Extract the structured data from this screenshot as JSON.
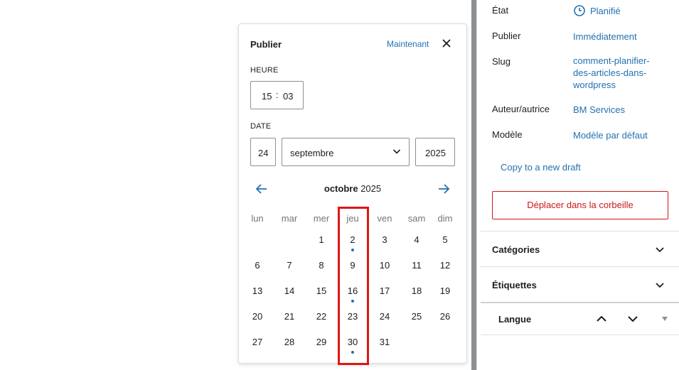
{
  "popover": {
    "title": "Publier",
    "now_label": "Maintenant",
    "close_icon": "close-icon",
    "time_label": "HEURE",
    "hours": "15",
    "separator": ":",
    "minutes": "03",
    "date_label": "DATE",
    "day": "24",
    "month": "septembre",
    "year": "2025"
  },
  "calendar": {
    "month_name": "octobre",
    "year": "2025",
    "weekdays": [
      "lun",
      "mar",
      "mer",
      "jeu",
      "ven",
      "sam",
      "dim"
    ],
    "weeks": [
      [
        "",
        "",
        "1",
        "2",
        "3",
        "4",
        "5"
      ],
      [
        "6",
        "7",
        "8",
        "9",
        "10",
        "11",
        "12"
      ],
      [
        "13",
        "14",
        "15",
        "16",
        "17",
        "18",
        "19"
      ],
      [
        "20",
        "21",
        "22",
        "23",
        "24",
        "25",
        "26"
      ],
      [
        "27",
        "28",
        "29",
        "30",
        "31",
        "",
        ""
      ]
    ],
    "days_with_posts": [
      "2",
      "16",
      "30"
    ],
    "highlighted_column": "jeu",
    "highlight_color": "#e01515"
  },
  "sidebar": {
    "rows": [
      {
        "label": "État",
        "value": "Planifié",
        "icon": "clock-icon"
      },
      {
        "label": "Publier",
        "value": "Immédiatement"
      },
      {
        "label": "Slug",
        "value_lines": [
          "comment-planifier-",
          "des-articles-dans-",
          "wordpress"
        ]
      },
      {
        "label": "Auteur/autrice",
        "value": "BM Services"
      },
      {
        "label": "Modèle",
        "value": "Modèle par défaut"
      }
    ],
    "copy_draft": "Copy to a new draft",
    "trash": "Déplacer dans la corbeille",
    "panels": [
      {
        "title": "Catégories"
      },
      {
        "title": "Étiquettes"
      }
    ],
    "language_title": "Langue"
  },
  "colors": {
    "accent": "#2271b1",
    "danger": "#cc1818"
  }
}
